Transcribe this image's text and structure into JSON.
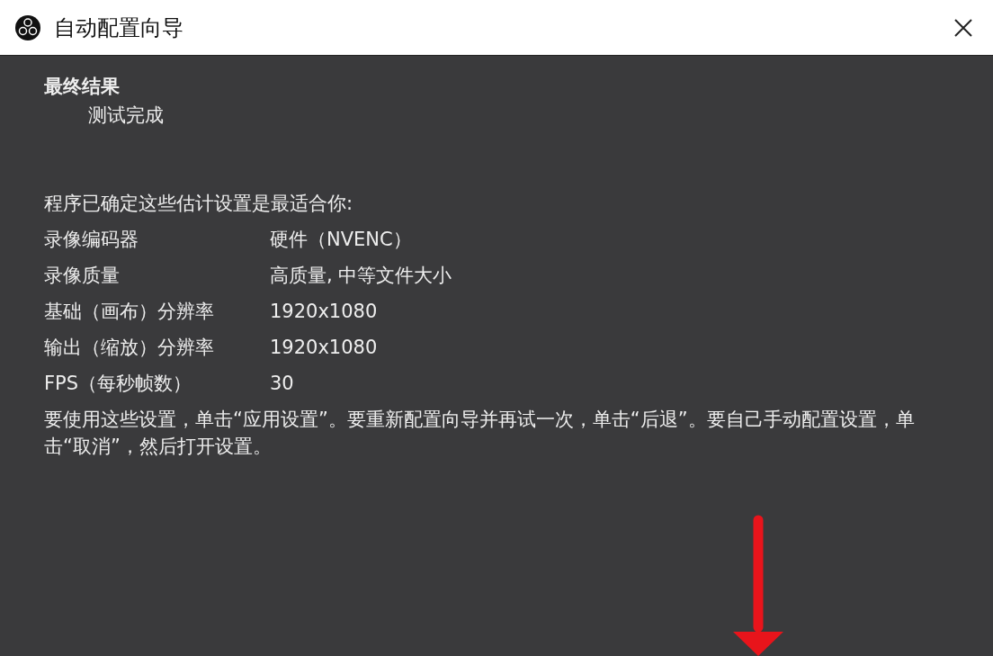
{
  "window": {
    "title": "自动配置向导"
  },
  "heading": "最终结果",
  "subheading": "测试完成",
  "intro": "程序已确定这些估计设置是最适合你:",
  "settings": [
    {
      "label": "录像编码器",
      "value": "硬件（NVENC）"
    },
    {
      "label": "录像质量",
      "value": "高质量, 中等文件大小"
    },
    {
      "label": "基础（画布）分辨率",
      "value": "1920x1080"
    },
    {
      "label": "输出（缩放）分辨率",
      "value": "1920x1080"
    },
    {
      "label": "FPS（每秒帧数）",
      "value": "30"
    }
  ],
  "instructions": "要使用这些设置，单击“应用设置”。要重新配置向导并再试一次，单击“后退”。要自己手动配置设置，单击“取消”，然后打开设置。"
}
